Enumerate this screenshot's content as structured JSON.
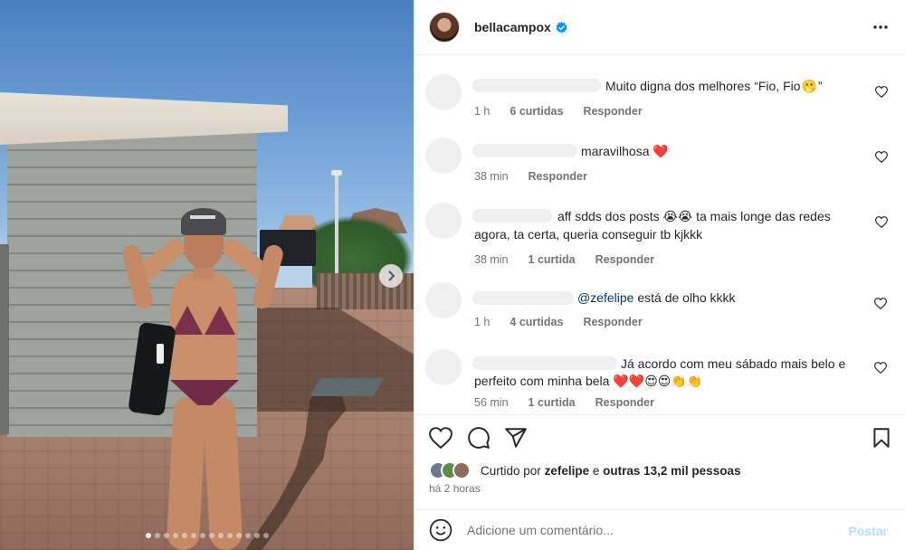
{
  "post": {
    "username": "bellacampox",
    "verified": true,
    "carousel": {
      "slide_count": 14,
      "active_index": 0
    }
  },
  "comments": [
    {
      "text": "Muito digna dos melhores “Fio, Fio",
      "emoji_after": "🫢",
      "text_end": "”",
      "time": "1 h",
      "likes": "6 curtidas",
      "reply": "Responder"
    },
    {
      "text": "maravilhosa",
      "emoji_after": "❤️",
      "time": "38 min",
      "reply": "Responder"
    },
    {
      "text_a": "aff sdds dos posts",
      "emojis_a": [
        "😭",
        "😭"
      ],
      "text_b": "ta mais longe das redes",
      "line2": "agora, ta certa, queria conseguir tb kjkkk",
      "time": "38 min",
      "likes": "1 curtida",
      "reply": "Responder"
    },
    {
      "mention": "@zefelipe",
      "text": "está de olho kkkk",
      "time": "1 h",
      "likes": "4 curtidas",
      "reply": "Responder"
    },
    {
      "line1": "Já acordo com meu sábado mais belo e",
      "line2": "perfeito com minha bela",
      "emojis": [
        "❤️",
        "❤️",
        "😍",
        "😍",
        "👏",
        "👏"
      ],
      "time": "56 min",
      "likes": "1 curtida",
      "reply": "Responder"
    }
  ],
  "likes": {
    "prefix": "Curtido por",
    "user": "zefelipe",
    "joiner": "e",
    "others": "outras 13,2 mil pessoas"
  },
  "time_ago": "há 2 horas",
  "comment_box": {
    "placeholder": "Adicione um comentário...",
    "post_label": "Postar"
  },
  "colors": {
    "verified": "#0095f6",
    "heart_red": "#ed4956",
    "post_disabled": "#b2dffc",
    "muted": "#737373",
    "mention": "#00376b"
  },
  "icons": {
    "header": [
      "verified-badge-icon",
      "more-options-icon"
    ],
    "actions": [
      "heart-icon",
      "comment-icon",
      "share-icon",
      "bookmark-icon"
    ],
    "comment_box": [
      "emoji-icon"
    ]
  }
}
